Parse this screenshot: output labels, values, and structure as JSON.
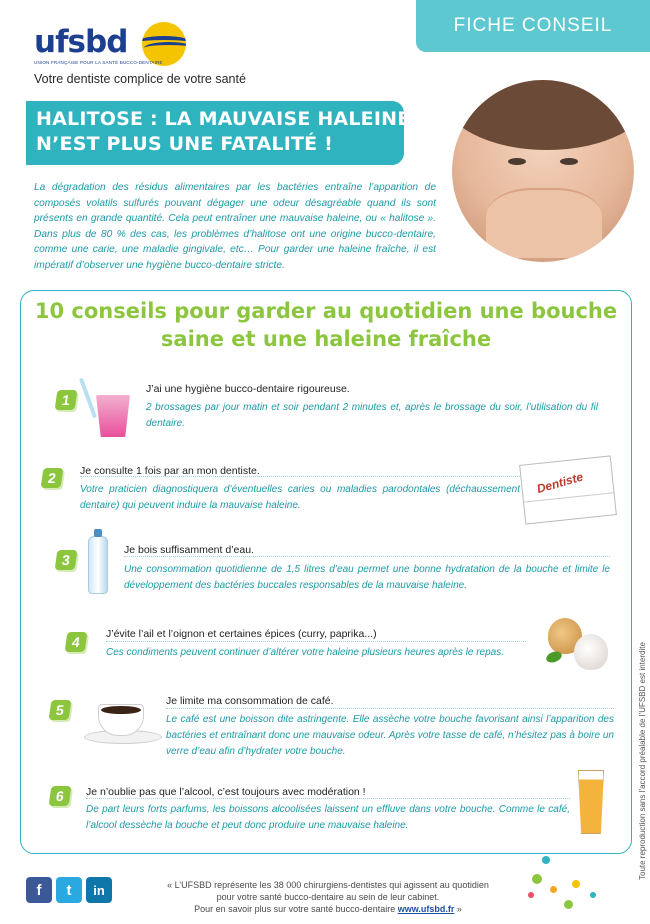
{
  "header": {
    "logo_text": "ufsbd",
    "logo_subtitle": "UNION FRANÇAISE POUR LA SANTÉ BUCCO-DENTAIRE",
    "tagline": "Votre dentiste complice de votre santé",
    "fiche_label": "FICHE CONSEIL"
  },
  "title": {
    "line1": "HALITOSE : LA MAUVAISE HALEINE",
    "line2": "N’EST PLUS UNE FATALITÉ !"
  },
  "intro": "La dégradation des résidus alimentaires par les bactéries entraîne l’apparition de composés volatils sulfurés pouvant dégager une odeur désagréable quand ils sont présents en grande quantité. Cela peut entraîner une mauvaise haleine, ou « halitose ». Dans plus de 80 % des cas, les problèmes d’halitose ont une origine bucco-dentaire, comme une carie, une maladie gingivale, etc… Pour garder une haleine fraîche, il est impératif d’observer une hygiène bucco-dentaire stricte.",
  "card": {
    "title_line1": "10 conseils pour garder au quotidien une bouche",
    "title_line2": "saine et une haleine fraîche",
    "tips": [
      {
        "number": "1",
        "title": "J’ai une hygiène bucco-dentaire rigoureuse.",
        "desc": "2 brossages par jour matin et soir pendant 2 minutes et, après le brossage du soir, l’utilisation du fil dentaire."
      },
      {
        "number": "2",
        "title": "Je consulte 1 fois par an mon dentiste.",
        "desc": "Votre praticien diagnostiquera d’éventuelles caries ou maladies parodontales (déchaussement dentaire) qui peuvent induire la mauvaise haleine."
      },
      {
        "number": "3",
        "title": "Je bois suffisamment d’eau.",
        "desc": "Une consommation quotidienne de 1,5 litres d’eau permet une bonne hydratation de la bouche et limite le développement des bactéries buccales responsables de la mauvaise haleine."
      },
      {
        "number": "4",
        "title": "J’évite l’ail et l’oignon et certaines épices (curry, paprika...)",
        "desc": "Ces condiments peuvent continuer d’altérer votre haleine plusieurs heures après le repas."
      },
      {
        "number": "5",
        "title": "Je limite ma consommation de café.",
        "desc": "Le café est une boisson dite astringente. Elle assèche votre bouche favorisant ainsi l’apparition des bactéries et entraînant donc une mauvaise odeur. Après votre tasse de café, n’hésitez pas à boire un verre d’eau afin d’hydrater votre bouche."
      },
      {
        "number": "6",
        "title": "Je n’oublie pas que l’alcool, c’est toujours avec modération !",
        "desc": "De part leurs forts parfums, les boissons alcoolisées laissent un effluve dans votre bouche. Comme le café, l’alcool dessèche la bouche et peut donc produire une mauvaise haleine."
      }
    ],
    "calendar_word": "Dentiste"
  },
  "footer": {
    "social": [
      "f",
      "t",
      "in"
    ],
    "line1": "« L’UFSBD représente les 38 000 chirurgiens-dentistes qui agissent au quotidien",
    "line2": "pour votre santé bucco-dentaire au sein de leur cabinet.",
    "line3_prefix": "Pour en savoir plus sur votre santé bucco-dentaire ",
    "link": "www.ufsbd.fr",
    "line3_suffix": " »",
    "vertical_note": "Toute reproduction sans l’accord préalable de l’UFSBD est interdite"
  },
  "colors": {
    "teal": "#2fb3bf",
    "light_teal": "#5ec8d1",
    "green": "#8cc63f",
    "navy": "#1d3f8f",
    "yellow": "#f5c400",
    "facebook": "#3b5998",
    "twitter": "#2aa9e0",
    "linkedin": "#0e76a8"
  }
}
